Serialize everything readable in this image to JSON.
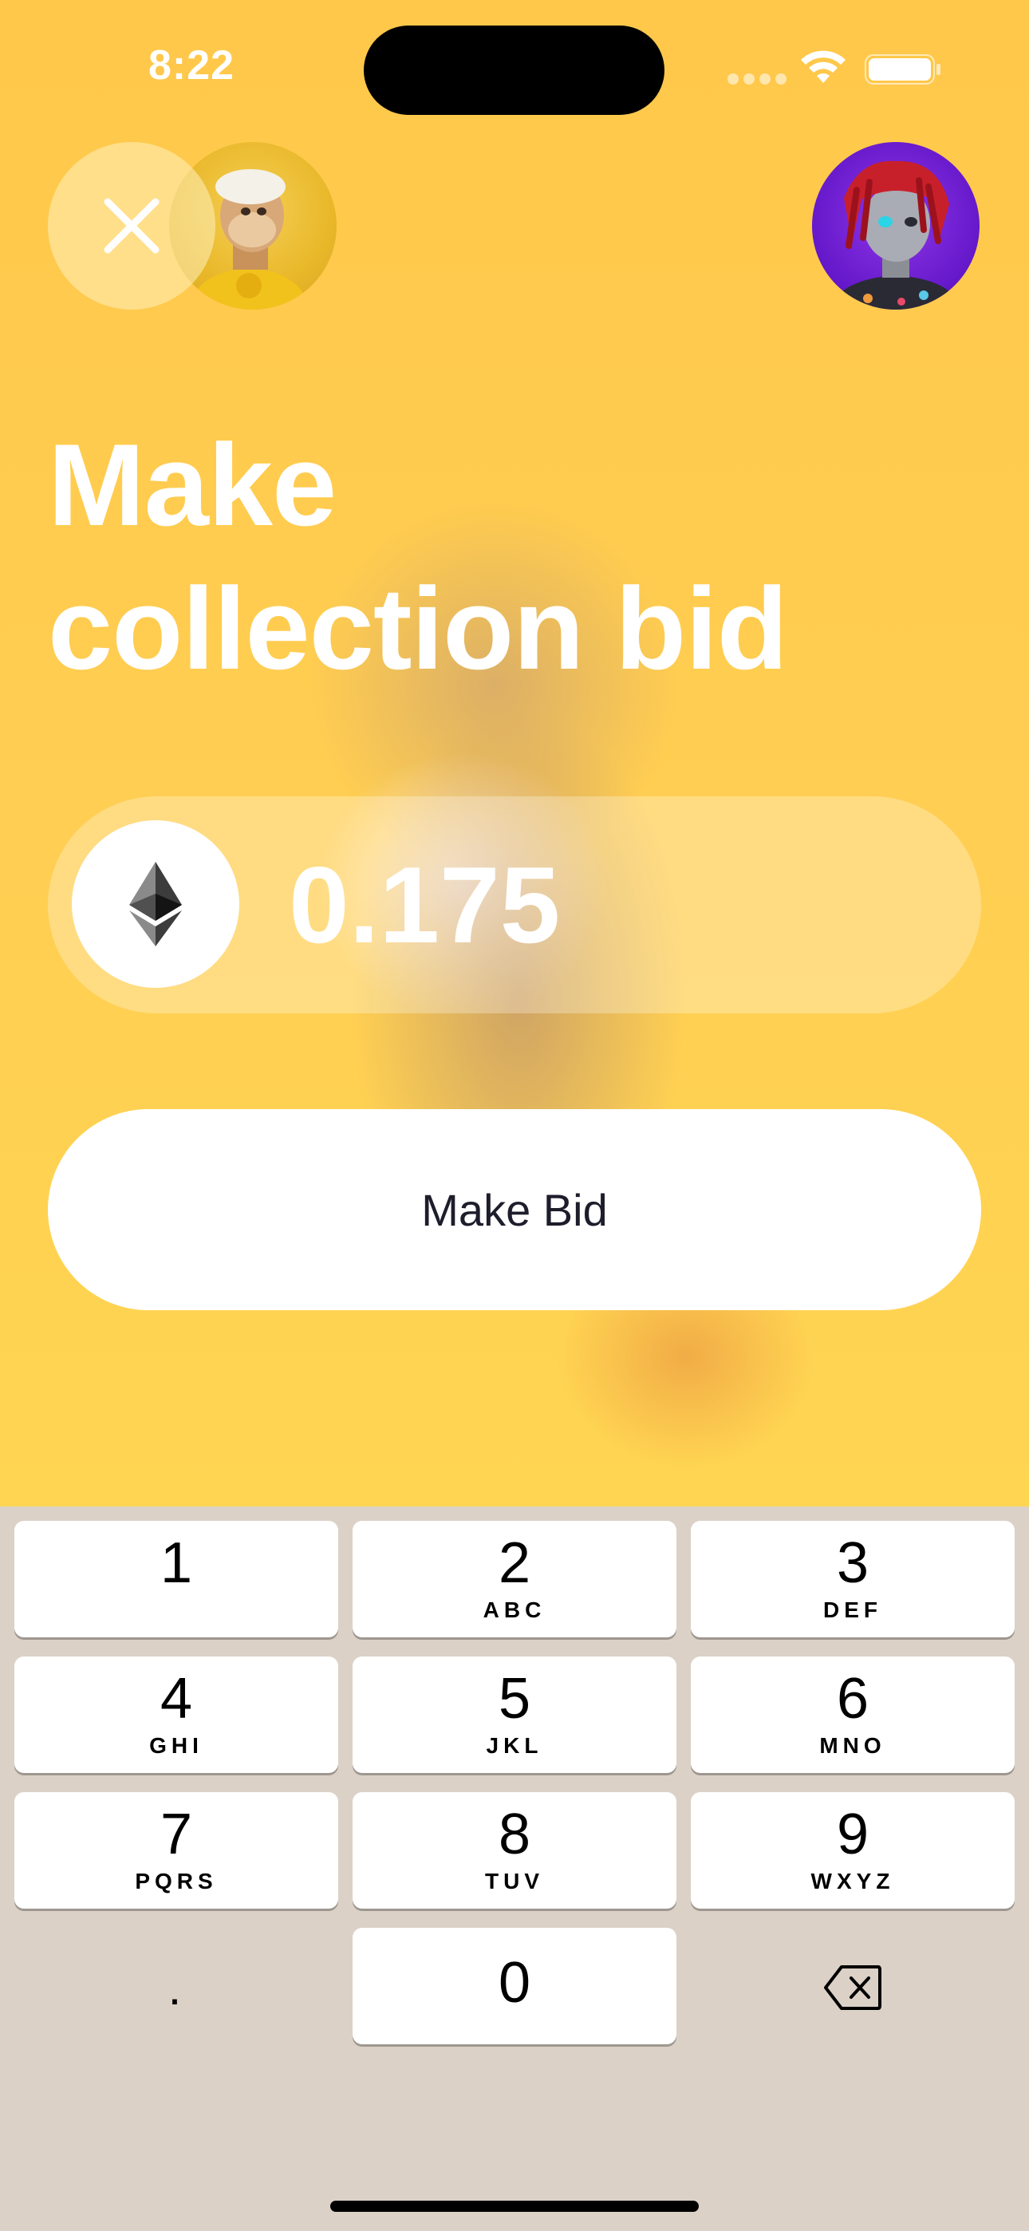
{
  "status_bar": {
    "time": "8:22"
  },
  "header": {
    "close_icon": "close-x-icon",
    "left_avatar": "ape-nft-avatar",
    "right_avatar": "red-dreadlocks-nft-avatar"
  },
  "title": {
    "line1": "Make",
    "line2": "collection bid"
  },
  "amount": {
    "currency_icon": "ethereum-icon",
    "value": "0.175"
  },
  "bid_button": {
    "label": "Make Bid"
  },
  "keypad": {
    "keys": [
      {
        "digit": "1",
        "letters": ""
      },
      {
        "digit": "2",
        "letters": "ABC"
      },
      {
        "digit": "3",
        "letters": "DEF"
      },
      {
        "digit": "4",
        "letters": "GHI"
      },
      {
        "digit": "5",
        "letters": "JKL"
      },
      {
        "digit": "6",
        "letters": "MNO"
      },
      {
        "digit": "7",
        "letters": "PQRS"
      },
      {
        "digit": "8",
        "letters": "TUV"
      },
      {
        "digit": "9",
        "letters": "WXYZ"
      },
      {
        "digit": "0",
        "letters": ""
      }
    ],
    "dot_label": ".",
    "delete_icon": "backspace-icon"
  },
  "colors": {
    "background": "#FFC94A",
    "keypad_background": "#DBD1C7",
    "button_text": "#1D1D2B"
  }
}
